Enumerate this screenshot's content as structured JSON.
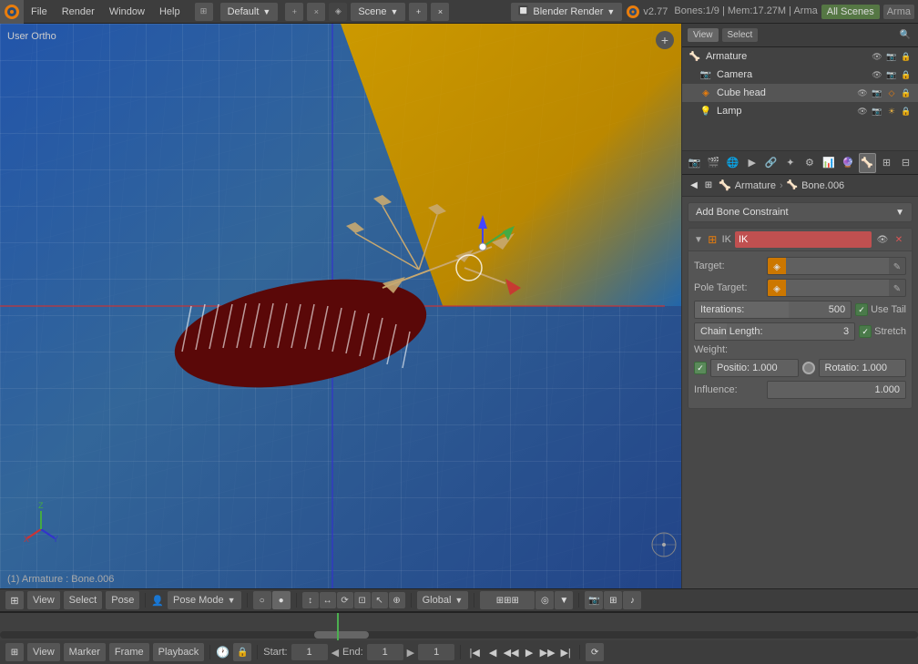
{
  "app": {
    "title": "Blender",
    "version": "v2.77",
    "stats": "Bones:1/9 | Mem:17.27M | Arma",
    "logo": "🔷"
  },
  "top_menu": {
    "items": [
      "File",
      "Render",
      "Window",
      "Help"
    ]
  },
  "workspace": {
    "label": "Default"
  },
  "scene": {
    "label": "Scene"
  },
  "engine": {
    "label": "Blender Render"
  },
  "all_scenes": {
    "label": "All Scenes",
    "suffix": "Arma"
  },
  "viewport": {
    "label": "User Ortho",
    "status": "(1) Armature : Bone.006"
  },
  "outliner": {
    "items": [
      {
        "name": "Armature",
        "icon": "🦴",
        "indent": 0,
        "type": "armature"
      },
      {
        "name": "Camera",
        "icon": "📷",
        "indent": 1,
        "type": "camera"
      },
      {
        "name": "Cube head",
        "icon": "🔶",
        "indent": 1,
        "type": "mesh"
      },
      {
        "name": "Lamp",
        "icon": "💡",
        "indent": 1,
        "type": "lamp"
      }
    ]
  },
  "breadcrumb": {
    "items": [
      "Armature",
      "Bone.006"
    ]
  },
  "add_constraint_btn": {
    "label": "Add Bone Constraint"
  },
  "constraint": {
    "toggle": "▼",
    "type_label": "IK",
    "name": "IK",
    "target_label": "Target:",
    "pole_target_label": "Pole Target:",
    "iterations_label": "Iterations:",
    "iterations_value": "500",
    "chain_length_label": "Chain Length:",
    "chain_length_value": "3",
    "use_tail_label": "Use Tail",
    "stretch_label": "Stretch",
    "weight_label": "Weight:",
    "position_label": "Positio: 1.000",
    "rotation_label": "Rotatio: 1.000",
    "influence_label": "Influence:",
    "influence_value": "1.000"
  },
  "bottom_toolbar": {
    "view_btn": "View",
    "select_btn": "Select",
    "pose_btn": "Pose",
    "mode_label": "Pose Mode",
    "global_label": "Global"
  },
  "timeline": {
    "view_btn": "View",
    "marker_btn": "Marker",
    "frame_btn": "Frame",
    "playback_btn": "Playback",
    "start_label": "Start:",
    "start_value": "1",
    "end_label": "End:",
    "end_value": "1",
    "current_value": "1"
  }
}
